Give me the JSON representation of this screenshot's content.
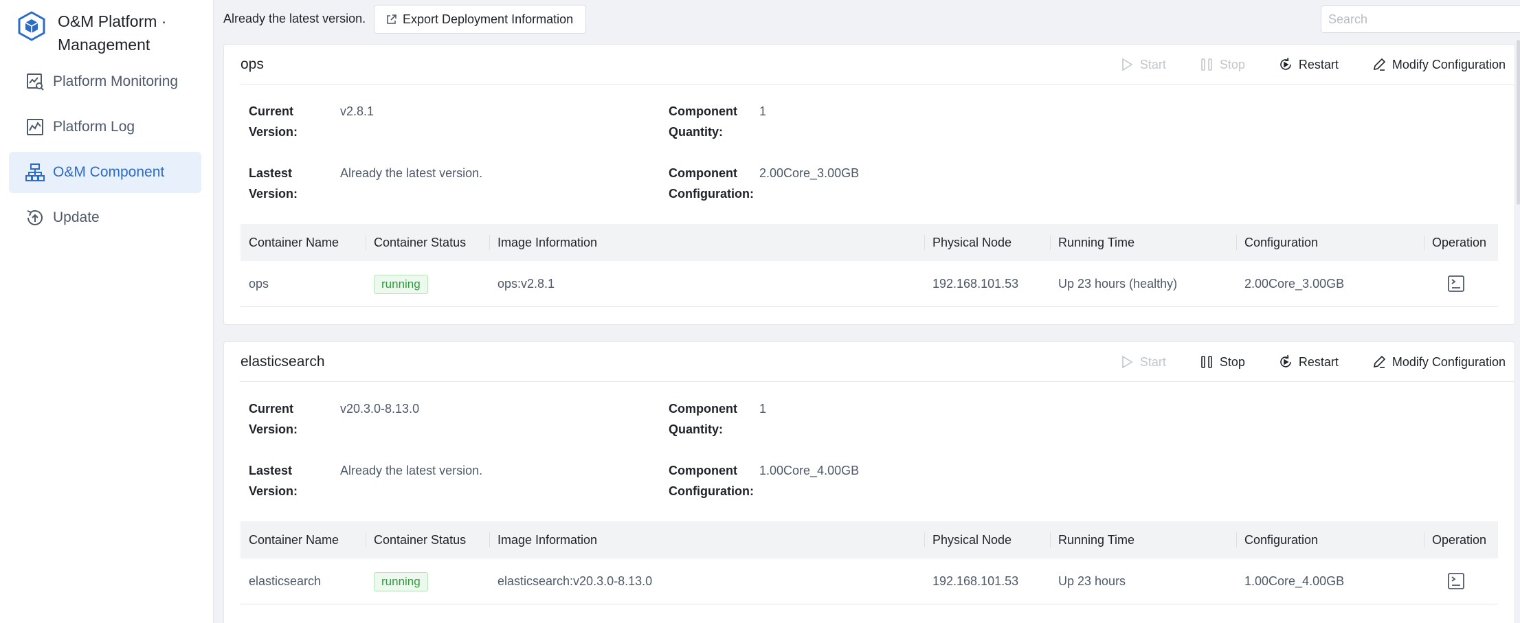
{
  "sidebar": {
    "brand_title": "O&M Platform · Management",
    "items": [
      {
        "label": "Platform Monitoring",
        "icon": "monitor-chart-icon",
        "active": false
      },
      {
        "label": "Platform Log",
        "icon": "log-chart-icon",
        "active": false
      },
      {
        "label": "O&M Component",
        "icon": "component-tree-icon",
        "active": true
      },
      {
        "label": "Update",
        "icon": "update-icon",
        "active": false
      }
    ]
  },
  "topbar": {
    "status_text": "Already the latest version.",
    "export_label": "Export Deployment Information",
    "search_placeholder": "Search"
  },
  "labels": {
    "start": "Start",
    "stop": "Stop",
    "restart": "Restart",
    "modify": "Modify Configuration",
    "current_version": "Current Version:",
    "latest_version": "Lastest Version:",
    "component_quantity": "Component Quantity:",
    "component_configuration": "Component Configuration:"
  },
  "table_headers": [
    "Container Name",
    "Container Status",
    "Image Information",
    "Physical Node",
    "Running Time",
    "Configuration",
    "Operation"
  ],
  "components": [
    {
      "name": "ops",
      "start_enabled": false,
      "stop_enabled": false,
      "current_version": "v2.8.1",
      "latest_version": "Already the latest version.",
      "quantity": "1",
      "configuration": "2.00Core_3.00GB",
      "row": {
        "container_name": "ops",
        "status": "running",
        "image": "ops:v2.8.1",
        "node": "192.168.101.53",
        "running_time": "Up 23 hours (healthy)",
        "configuration": "2.00Core_3.00GB"
      }
    },
    {
      "name": "elasticsearch",
      "start_enabled": false,
      "stop_enabled": true,
      "current_version": "v20.3.0-8.13.0",
      "latest_version": "Already the latest version.",
      "quantity": "1",
      "configuration": "1.00Core_4.00GB",
      "row": {
        "container_name": "elasticsearch",
        "status": "running",
        "image": "elasticsearch:v20.3.0-8.13.0",
        "node": "192.168.101.53",
        "running_time": "Up 23 hours",
        "configuration": "1.00Core_4.00GB"
      }
    }
  ],
  "colors": {
    "accent": "#2c6cc9",
    "active_bg": "#e8f0fb",
    "running_green": "#2e9d3a",
    "disabled": "#c2c6cc"
  }
}
